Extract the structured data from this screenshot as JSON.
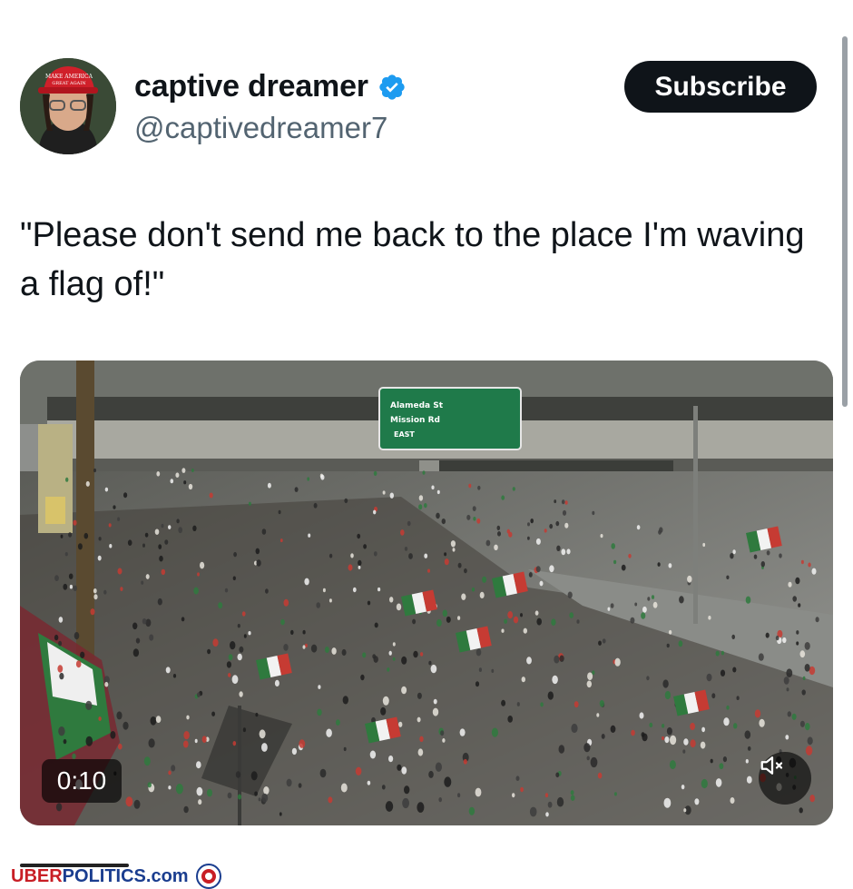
{
  "post": {
    "display_name": "captive dreamer",
    "handle": "@captivedreamer7",
    "subscribe_label": "Subscribe",
    "text": "\"Please don't send me back to the place I'm waving a flag of!\""
  },
  "video": {
    "timestamp": "0:10",
    "sign": {
      "line1": "Alameda St",
      "line2": "Mission Rd",
      "line3": "EAST"
    }
  },
  "watermark": {
    "part1": "UBER",
    "part2": "POLITICS.com"
  },
  "colors": {
    "verified": "#1d9bf0",
    "subscribe_bg": "#0f1419",
    "sign_green": "#1f7a4a"
  },
  "icons": {
    "verified": "verified-badge-icon",
    "mute": "speaker-muted-icon"
  }
}
